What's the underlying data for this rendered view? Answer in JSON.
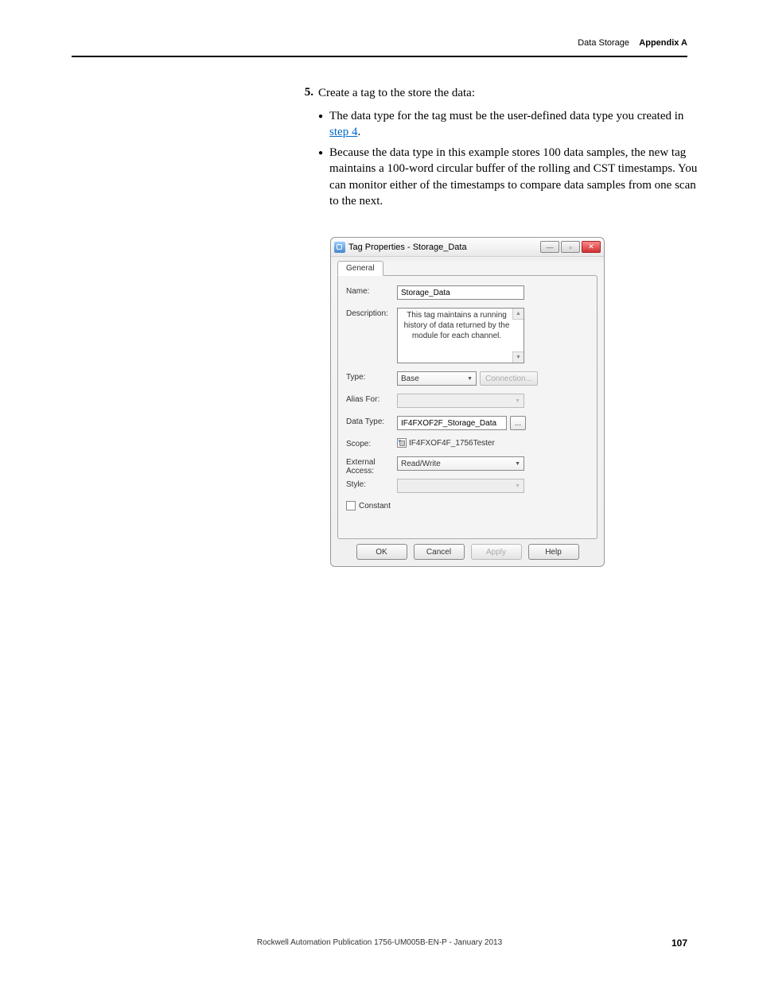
{
  "header": {
    "section": "Data Storage",
    "appendix": "Appendix A"
  },
  "step": {
    "number": "5.",
    "text": "Create a tag to the store the data:"
  },
  "bullets": [
    {
      "pre": "The data type for the tag must be the user-defined data type you created in ",
      "link": "step 4",
      "post": "."
    },
    {
      "pre": "Because the data type in this example stores 100 data samples, the new tag maintains a 100-word circular buffer of the rolling and CST timestamps. You can monitor either of the timestamps to compare data samples from one scan to the next.",
      "link": "",
      "post": ""
    }
  ],
  "dialog": {
    "title": "Tag Properties - Storage_Data",
    "tab": "General",
    "labels": {
      "name": "Name:",
      "description": "Description:",
      "type": "Type:",
      "aliasFor": "Alias For:",
      "dataType": "Data Type:",
      "scope": "Scope:",
      "externalAccess": "External\nAccess:",
      "style": "Style:",
      "constant": "Constant"
    },
    "values": {
      "name": "Storage_Data",
      "description": "This tag maintains a running history of data returned by the module for each channel.",
      "type": "Base",
      "connection": "Connection...",
      "aliasFor": "",
      "dataType": "IF4FXOF2F_Storage_Data",
      "browse": "...",
      "scope": "IF4FXOF4F_1756Tester",
      "externalAccess": "Read/Write",
      "style": ""
    },
    "buttons": {
      "ok": "OK",
      "cancel": "Cancel",
      "apply": "Apply",
      "help": "Help"
    }
  },
  "footer": {
    "text": "Rockwell Automation Publication 1756-UM005B-EN-P - January 2013",
    "page": "107"
  }
}
